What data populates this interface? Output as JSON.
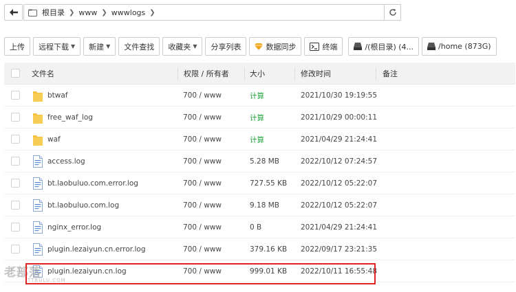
{
  "address": {
    "crumbs": [
      "根目录",
      "www",
      "wwwlogs"
    ]
  },
  "toolbar": {
    "upload": "上传",
    "remote_download": "远程下载",
    "new": "新建",
    "file_search": "文件查找",
    "favorites": "收藏夹",
    "share_list": "分享列表",
    "data_sync": "数据同步",
    "terminal": "终端",
    "disk_root": "/(根目录) (4...",
    "disk_home": "/home (873G)"
  },
  "table": {
    "headers": {
      "name": "文件名",
      "perm": "权限 / 所有者",
      "size": "大小",
      "mtime": "修改时间",
      "note": "备注"
    },
    "rows": [
      {
        "type": "folder",
        "name": "btwaf",
        "perm": "700 / www",
        "size": "计算",
        "mtime": "2021/10/30 19:19:55"
      },
      {
        "type": "folder",
        "name": "free_waf_log",
        "perm": "700 / www",
        "size": "计算",
        "mtime": "2021/10/29 00:00:11"
      },
      {
        "type": "folder",
        "name": "waf",
        "perm": "700 / www",
        "size": "计算",
        "mtime": "2021/04/29 21:24:41"
      },
      {
        "type": "file",
        "name": "access.log",
        "perm": "700 / www",
        "size": "5.28 MB",
        "mtime": "2022/10/12 07:24:57"
      },
      {
        "type": "file",
        "name": "bt.laobuluo.com.error.log",
        "perm": "700 / www",
        "size": "727.55 KB",
        "mtime": "2022/10/12 05:22:07"
      },
      {
        "type": "file",
        "name": "bt.laobuluo.com.log",
        "perm": "700 / www",
        "size": "9.18 MB",
        "mtime": "2022/10/12 05:22:07"
      },
      {
        "type": "file",
        "name": "nginx_error.log",
        "perm": "700 / www",
        "size": "0 B",
        "mtime": "2021/04/29 21:24:41"
      },
      {
        "type": "file",
        "name": "plugin.lezaiyun.cn.error.log",
        "perm": "700 / www",
        "size": "379.16 KB",
        "mtime": "2022/09/17 23:21:35"
      },
      {
        "type": "file",
        "name": "plugin.lezaiyun.cn.log",
        "perm": "700 / www",
        "size": "999.01 KB",
        "mtime": "2022/10/11 16:55:48"
      }
    ]
  },
  "watermark": {
    "main": "老部落",
    "sub": "TTBULU.COM"
  },
  "colors": {
    "calc": "#20a53a",
    "highlight": "#e02424",
    "folder": "#f5c242",
    "file": "#5b8fd6"
  }
}
